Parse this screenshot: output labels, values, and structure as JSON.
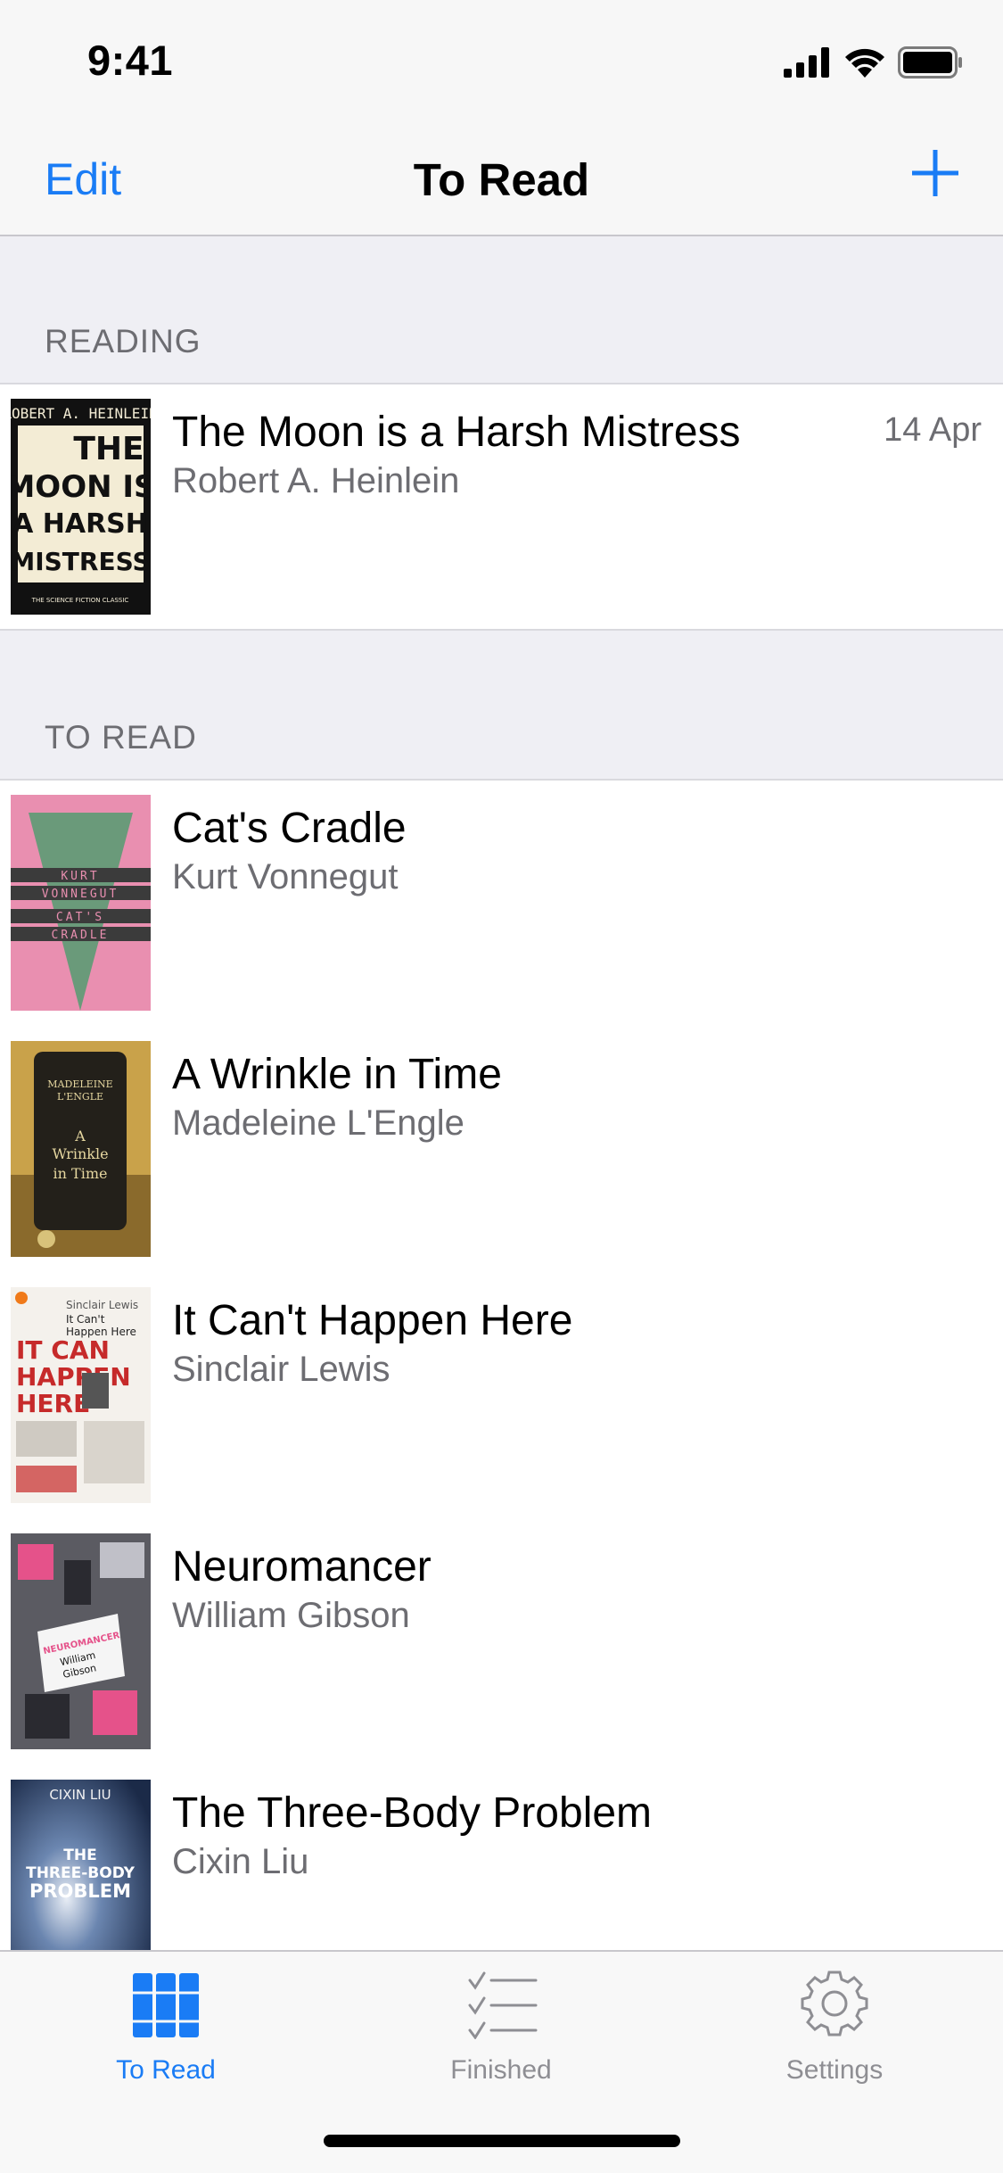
{
  "status": {
    "time": "9:41"
  },
  "nav": {
    "edit_label": "Edit",
    "title": "To Read"
  },
  "sections": {
    "reading": "READING",
    "to_read": "TO READ"
  },
  "reading": [
    {
      "title": "The Moon is a Harsh Mistress",
      "author": "Robert A. Heinlein",
      "date": "14 Apr",
      "cover_lines": [
        "ROBERT A. HEINLEIN",
        "THE",
        "MOON IS",
        "A HARSH",
        "MISTRESS",
        "THE SCIENCE FICTION CLASSIC"
      ]
    }
  ],
  "to_read": [
    {
      "title": "Cat's Cradle",
      "author": "Kurt Vonnegut",
      "cover_lines": [
        "KURT",
        "VONNEGUT",
        "CAT'S",
        "CRADLE"
      ]
    },
    {
      "title": "A Wrinkle in Time",
      "author": "Madeleine L'Engle",
      "cover_lines": [
        "MADELEINE",
        "L'ENGLE",
        "A",
        "Wrinkle",
        "in Time"
      ]
    },
    {
      "title": "It Can't Happen Here",
      "author": "Sinclair Lewis",
      "cover_lines": [
        "Sinclair Lewis",
        "It Can't",
        "Happen Here",
        "IT CAN",
        "HAPPEN",
        "HERE"
      ]
    },
    {
      "title": "Neuromancer",
      "author": "William Gibson",
      "cover_lines": [
        "NEUROMANCER",
        "William",
        "Gibson"
      ]
    },
    {
      "title": "The Three-Body Problem",
      "author": "Cixin Liu",
      "cover_lines": [
        "CIXIN LIU",
        "THE",
        "THREE-BODY",
        "PROBLEM"
      ]
    }
  ],
  "tabs": [
    {
      "label": "To Read",
      "icon": "books-icon",
      "active": true
    },
    {
      "label": "Finished",
      "icon": "checklist-icon",
      "active": false
    },
    {
      "label": "Settings",
      "icon": "gear-icon",
      "active": false
    }
  ],
  "colors": {
    "accent": "#1a7cf5",
    "inactive": "#8e8e93"
  }
}
